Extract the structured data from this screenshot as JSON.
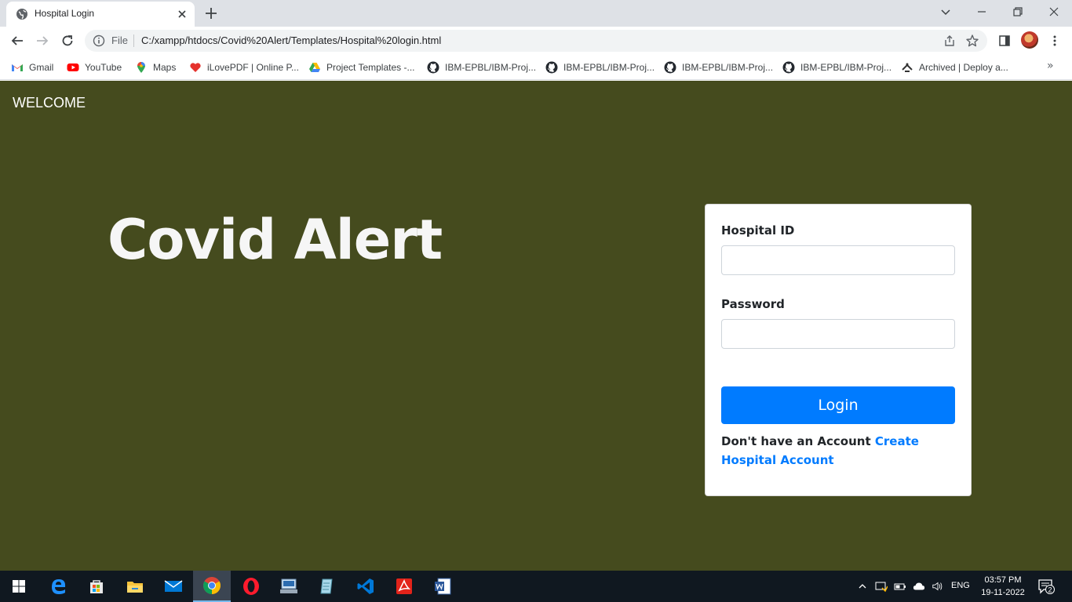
{
  "browser": {
    "tab": {
      "title": "Hospital Login"
    },
    "omnibox": {
      "scheme_label": "File",
      "url": "C:/xampp/htdocs/Covid%20Alert/Templates/Hospital%20login.html"
    },
    "bookmarks": [
      {
        "label": "Gmail",
        "icon": "gmail-icon"
      },
      {
        "label": "YouTube",
        "icon": "youtube-icon"
      },
      {
        "label": "Maps",
        "icon": "maps-icon"
      },
      {
        "label": "iLovePDF | Online P...",
        "icon": "ilovepdf-icon"
      },
      {
        "label": "Project Templates -...",
        "icon": "drive-icon"
      },
      {
        "label": "IBM-EPBL/IBM-Proj...",
        "icon": "github-icon"
      },
      {
        "label": "IBM-EPBL/IBM-Proj...",
        "icon": "github-icon"
      },
      {
        "label": "IBM-EPBL/IBM-Proj...",
        "icon": "github-icon"
      },
      {
        "label": "IBM-EPBL/IBM-Proj...",
        "icon": "github-icon"
      },
      {
        "label": "Archived | Deploy a...",
        "icon": "deploy-icon"
      }
    ],
    "more_bookmarks": "»"
  },
  "page": {
    "welcome": "WELCOME",
    "hero_title": "Covid Alert",
    "form": {
      "id_label": "Hospital ID",
      "id_value": "",
      "password_label": "Password",
      "password_value": "",
      "login_label": "Login",
      "signup_text": "Don't have an Account",
      "signup_link": "Create Hospital Account"
    },
    "colors": {
      "background": "#454b1e",
      "primary": "#007bff"
    }
  },
  "taskbar": {
    "apps": [
      "windows-start-icon",
      "edge-icon",
      "store-icon",
      "file-explorer-icon",
      "mail-icon",
      "chrome-icon",
      "opera-icon",
      "network-app-icon",
      "notepad-icon",
      "vscode-icon",
      "acrobat-icon",
      "word-icon"
    ],
    "lang": "ENG",
    "time": "03:57 PM",
    "date": "19-11-2022",
    "notification_count": "2"
  }
}
